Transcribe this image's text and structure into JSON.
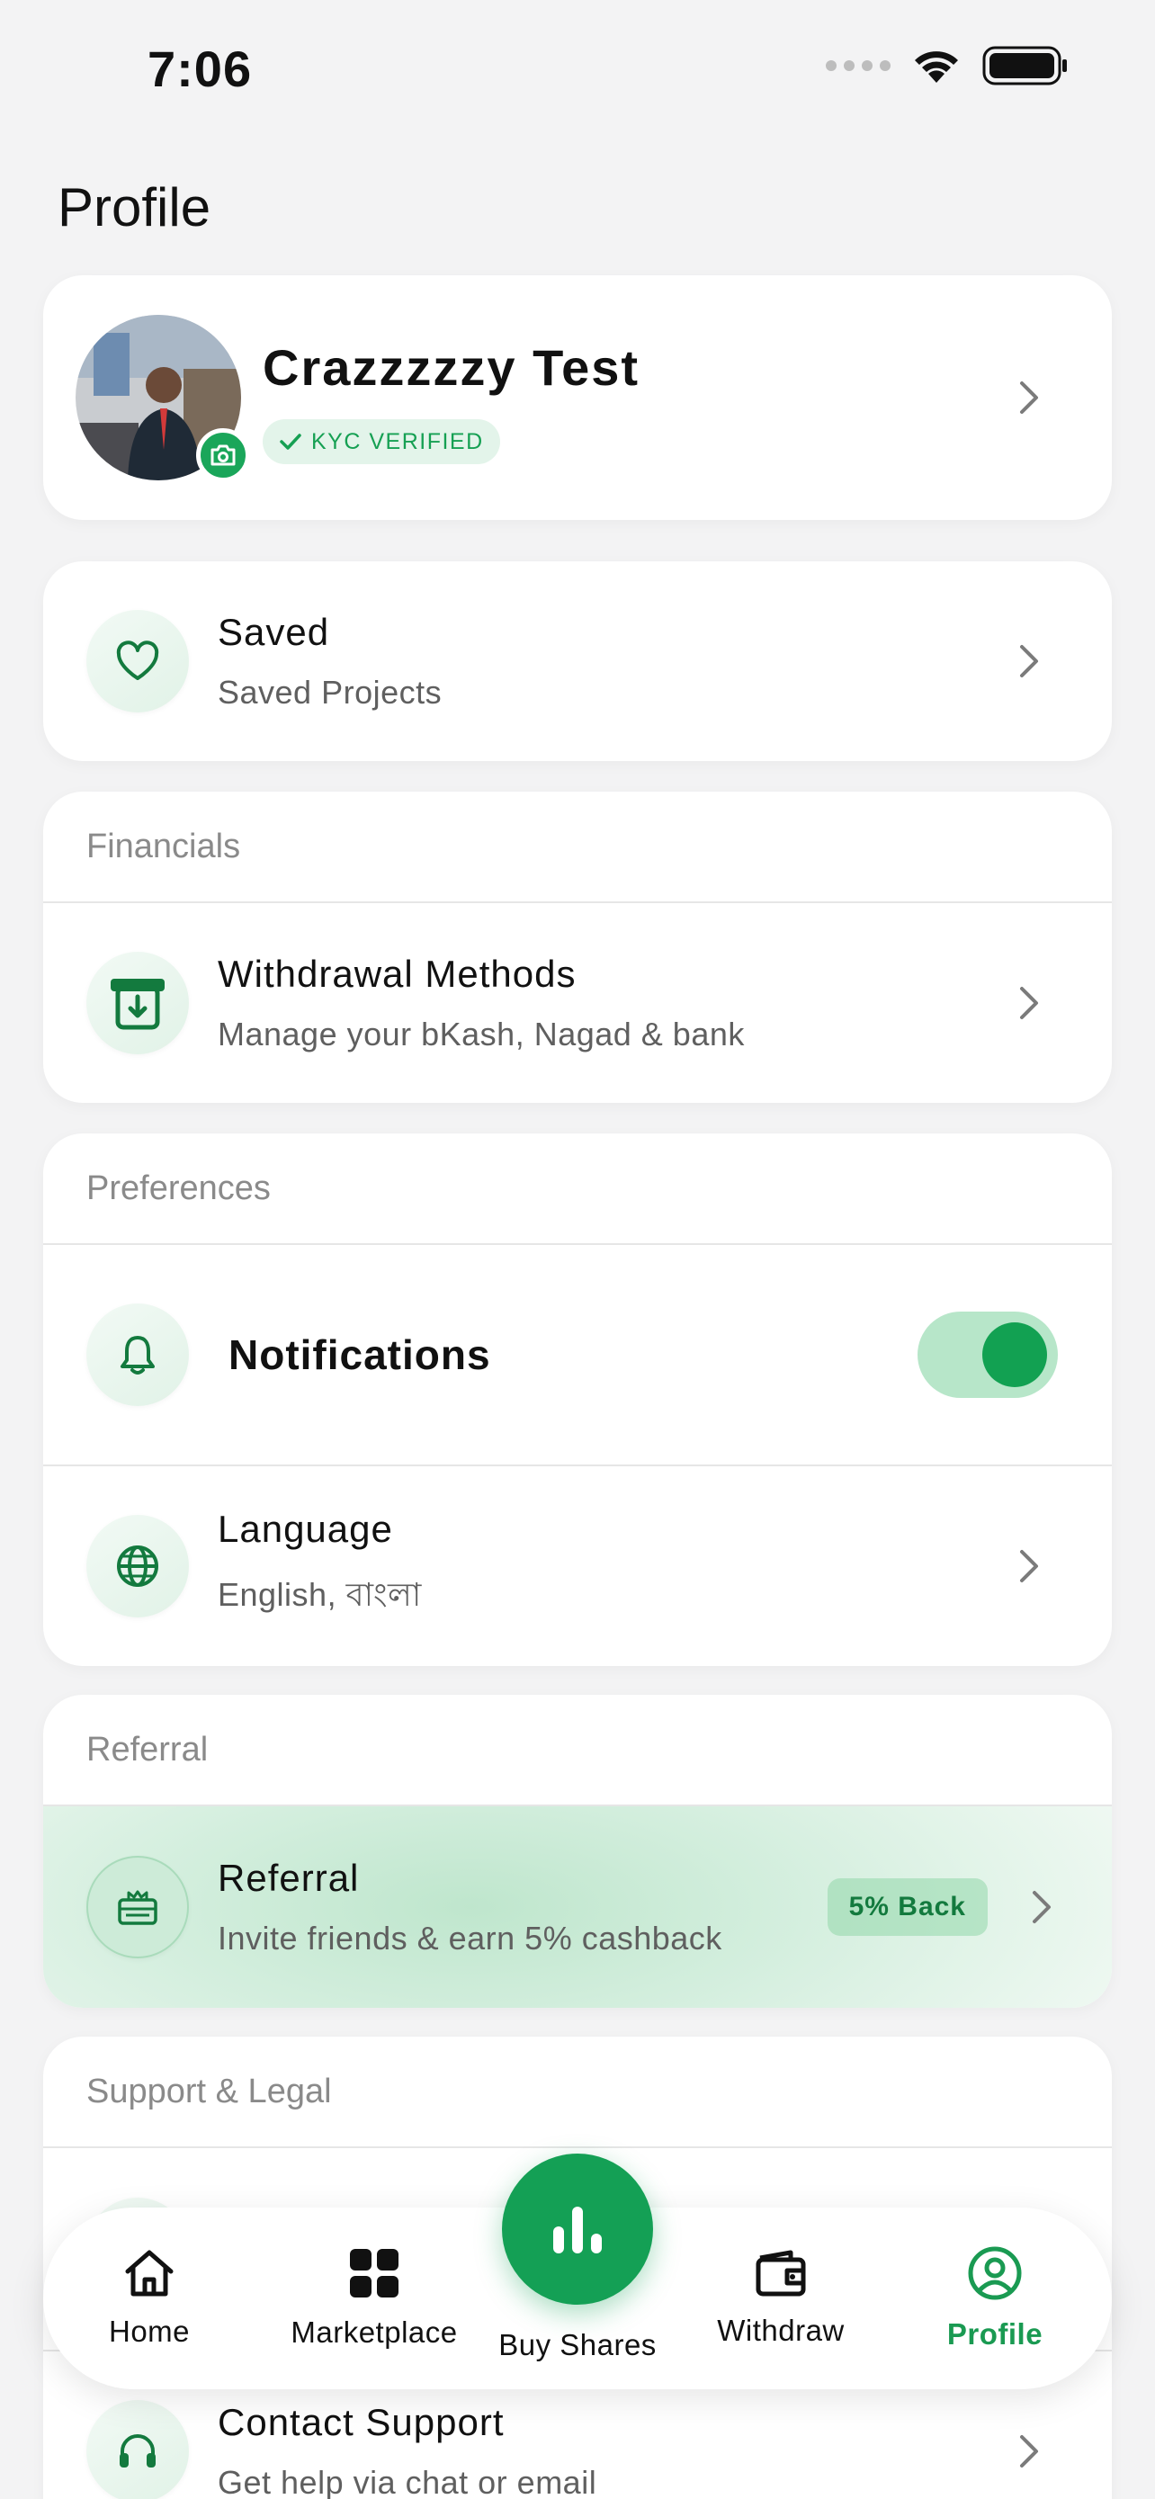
{
  "status_bar": {
    "time": "7:06"
  },
  "page": {
    "title": "Profile"
  },
  "profile": {
    "name": "Crazzzzzy Test",
    "kyc_label": "KYC VERIFIED"
  },
  "saved": {
    "title": "Saved",
    "subtitle": "Saved Projects"
  },
  "financials": {
    "section_title": "Financials",
    "withdrawal": {
      "title": "Withdrawal Methods",
      "subtitle": "Manage your bKash, Nagad & bank"
    }
  },
  "preferences": {
    "section_title": "Preferences",
    "notifications": {
      "title": "Notifications",
      "enabled": true
    },
    "language": {
      "title": "Language",
      "subtitle": "English, বাংলা"
    }
  },
  "referral": {
    "section_title": "Referral",
    "item": {
      "title": "Referral",
      "subtitle": "Invite friends & earn 5% cashback",
      "badge": "5% Back"
    }
  },
  "support": {
    "section_title": "Support & Legal",
    "contact": {
      "title": "Contact Support",
      "subtitle": "Get help via chat or email"
    }
  },
  "nav": {
    "items": [
      {
        "label": "Home",
        "icon": "home-icon"
      },
      {
        "label": "Marketplace",
        "icon": "grid-icon"
      },
      {
        "label": "Buy Shares",
        "icon": "bar-chart-icon"
      },
      {
        "label": "Withdraw",
        "icon": "wallet-icon"
      },
      {
        "label": "Profile",
        "icon": "user-circle-icon",
        "active": true
      }
    ]
  },
  "colors": {
    "accent": "#14a055",
    "active_nav": "#1a9a52",
    "background": "#f3f3f4"
  }
}
